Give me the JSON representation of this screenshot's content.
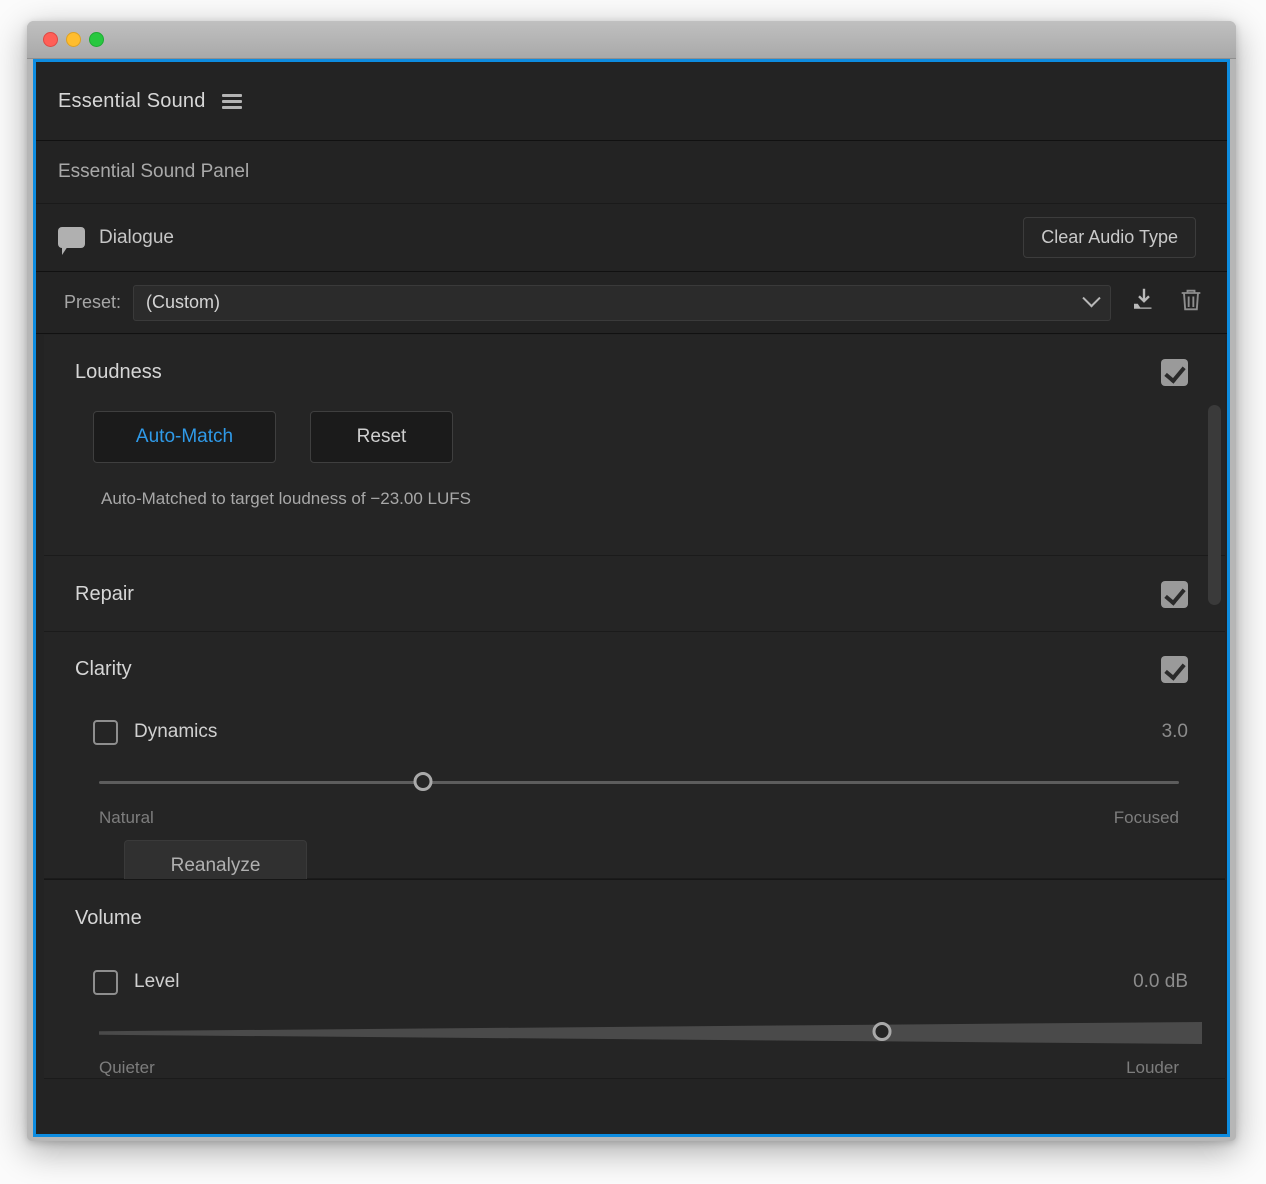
{
  "window": {
    "traffic_lights": [
      "close",
      "minimize",
      "zoom"
    ]
  },
  "panel": {
    "title": "Essential Sound",
    "menu_icon": "hamburger-menu-icon",
    "subtitle": "Essential Sound Panel"
  },
  "audio_type": {
    "icon": "speech-bubble-icon",
    "label": "Dialogue",
    "clear_button": "Clear Audio Type"
  },
  "preset": {
    "label": "Preset:",
    "value": "(Custom)",
    "chevron_icon": "chevron-down-icon",
    "save_icon": "save-preset-icon",
    "delete_icon": "trash-icon"
  },
  "sections": {
    "loudness": {
      "title": "Loudness",
      "enabled": true,
      "auto_match_button": "Auto-Match",
      "reset_button": "Reset",
      "status": "Auto-Matched to target loudness of −23.00 LUFS"
    },
    "repair": {
      "title": "Repair",
      "enabled": true
    },
    "clarity": {
      "title": "Clarity",
      "enabled": true,
      "dynamics": {
        "label": "Dynamics",
        "checked": false,
        "value": "3.0",
        "slider_percent": 30,
        "min_label": "Natural",
        "max_label": "Focused"
      },
      "reanalyze_button": "Reanalyze"
    },
    "volume": {
      "title": "Volume",
      "level": {
        "label": "Level",
        "checked": false,
        "value": "0.0 dB",
        "slider_percent": 71,
        "min_label": "Quieter",
        "max_label": "Louder"
      }
    }
  },
  "colors": {
    "accent_blue": "#2f9ae8",
    "focus_border": "#0d8ce0",
    "panel_bg": "#232323",
    "section_bg": "#252525"
  }
}
